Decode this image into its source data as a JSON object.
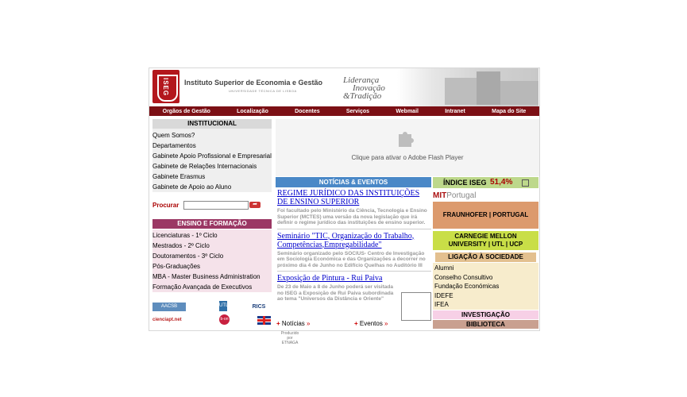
{
  "header": {
    "logo_text": "ISEG",
    "institution_name": "Instituto Superior de Economia e Gestão",
    "institution_sub": "UNIVERSIDADE TÉCNICA DE LISBOA",
    "motto": [
      "Liderança",
      "Inovação",
      "&Tradição"
    ]
  },
  "nav": [
    "Orgãos de Gestão",
    "Localização",
    "Docentes",
    "Serviços",
    "Webmail",
    "Intranet",
    "Mapa do Site"
  ],
  "institucional": {
    "title": "INSTITUCIONAL",
    "items": [
      "Quem Somos?",
      "Departamentos",
      "Gabinete Apoio Profissional e Empresarial",
      "Gabinete de Relações Internacionais",
      "Gabinete Erasmus",
      "Gabinete de Apoio ao Aluno"
    ]
  },
  "search": {
    "label": "Procurar",
    "value": "",
    "go": "➦"
  },
  "ensino": {
    "title": "ENSINO E FORMAÇÃO",
    "items": [
      "Licenciaturas - 1º Ciclo",
      "Mestrados - 2º Ciclo",
      "Doutoramentos - 3º Ciclo",
      "Pós-Graduações",
      "MBA - Master Business Administration",
      "Formação Avançada de Executivos"
    ]
  },
  "partner_logos": [
    "AACSB",
    "UTL",
    "RICS",
    "cienciapt.net",
    "b-on",
    "UK flag"
  ],
  "flash": {
    "text": "Clique para ativar o Adobe Flash Player"
  },
  "news": {
    "title": "NOTÍCIAS & EVENTOS",
    "items": [
      {
        "title": "REGIME JURÍDICO DAS INSTITUIÇÕES DE ENSINO SUPERIOR",
        "desc": "Foi facultado pelo Ministério da Ciência, Tecnologia e Ensino Superior (MCTES) uma versão da nova legislação que irá definir o regime jurídico das instituições de ensino superior."
      },
      {
        "title": "Seminário \"TIC, Organização do Trabalho, Competências,Empregabilidade\"",
        "desc": "Seminário organizado pelo SOCIUS- Centro de Investigação em Sociologia Económica e das Organizações a decorrer no próximo dia 4 de Junho no Edifício Quelhas no Auditório III"
      },
      {
        "title": "Exposição de Pintura - Rui Paiva",
        "desc": "De 23 de Maio a 8 de Junho poderá ser visitada no ISEG a Exposição de Rui Paiva subordinada ao tema \"Universos da Distância e Oriente\""
      }
    ],
    "more_news": "Notícias",
    "more_events": "Eventos"
  },
  "produced_by": [
    "Produzido",
    "por",
    "ETNAGA"
  ],
  "indice": {
    "label": "ÍNDICE ISEG",
    "value": "51,4%"
  },
  "mit": {
    "m": "MIT",
    "p": "Portugal"
  },
  "fraunhofer": "FRAUNHOFER | PORTUGAL",
  "cmu": [
    "CARNEGIE MELLON",
    "UNIVERSITY | UTL | UCP"
  ],
  "ligacao": {
    "title": "LIGAÇÃO À SOCIEDADE",
    "items": [
      "Alumni",
      "Conselho Consultivo",
      "Fundação Económicas",
      "IDEFE",
      "IFEA"
    ]
  },
  "investigacao": "INVESTIGAÇÃO",
  "biblioteca": "BIBLIOTECA"
}
